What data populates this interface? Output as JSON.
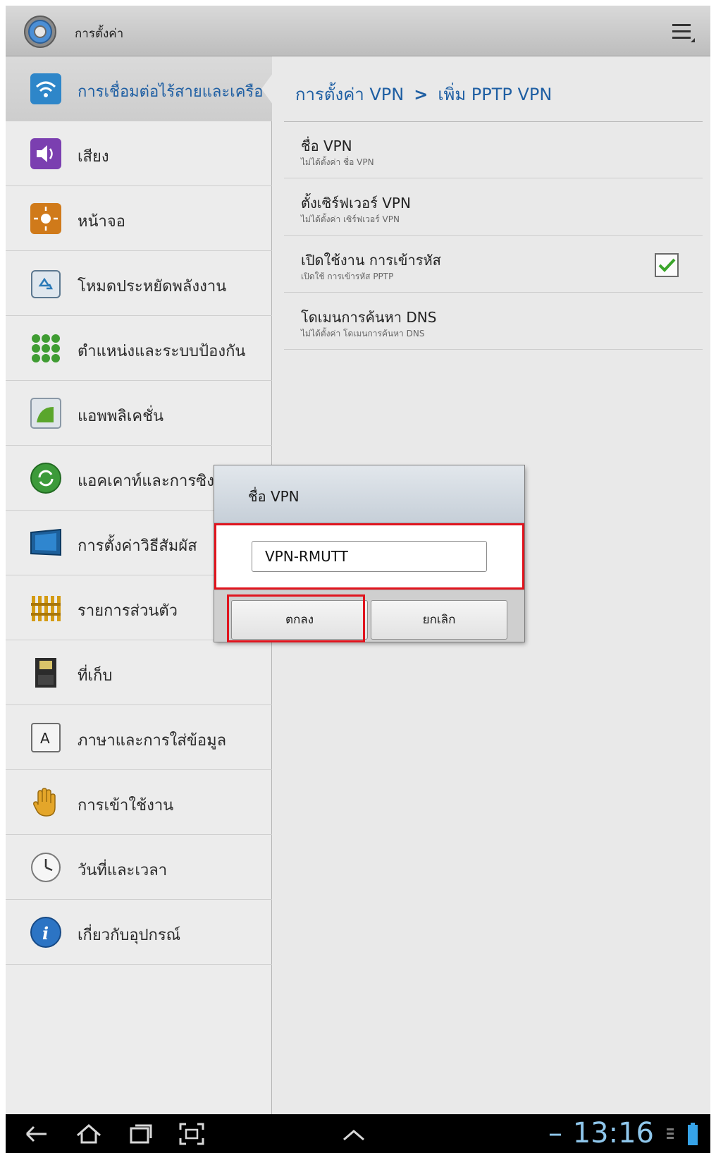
{
  "actionbar": {
    "title": "การตั้งค่า",
    "app_icon": "settings-gear-icon",
    "menu_icon": "menu-icon"
  },
  "sidebar": {
    "items": [
      {
        "label": "การเชื่อมต่อไร้สายและเครือข่าย",
        "icon": "wifi-icon",
        "selected": true
      },
      {
        "label": "เสียง",
        "icon": "speaker-icon"
      },
      {
        "label": "หน้าจอ",
        "icon": "brightness-icon"
      },
      {
        "label": "โหมดประหยัดพลังงาน",
        "icon": "power-saving-icon"
      },
      {
        "label": "ตำแหน่งและระบบป้องกัน",
        "icon": "location-lock-icon"
      },
      {
        "label": "แอพพลิเคชั่น",
        "icon": "android-icon"
      },
      {
        "label": "แอคเคาท์และการซิงค์",
        "icon": "sync-icon"
      },
      {
        "label": "การตั้งค่าวิธีสัมผัส",
        "icon": "motion-icon"
      },
      {
        "label": "รายการส่วนตัว",
        "icon": "privacy-icon"
      },
      {
        "label": "ที่เก็บ",
        "icon": "sd-card-icon"
      },
      {
        "label": "ภาษาและการใส่ข้อมูล",
        "icon": "keyboard-icon"
      },
      {
        "label": "การเข้าใช้งาน",
        "icon": "hand-icon"
      },
      {
        "label": "วันที่และเวลา",
        "icon": "clock-icon"
      },
      {
        "label": "เกี่ยวกับอุปกรณ์",
        "icon": "info-icon"
      }
    ]
  },
  "breadcrumb": {
    "parent": "การตั้งค่า VPN",
    "separator": ">",
    "current": "เพิ่ม PPTP VPN"
  },
  "vpn_settings": [
    {
      "title": "ชื่อ VPN",
      "subtitle": "ไม่ได้ตั้งค่า ชื่อ VPN"
    },
    {
      "title": "ตั้งเซิร์ฟเวอร์ VPN",
      "subtitle": "ไม่ได้ตั้งค่า เซิร์ฟเวอร์ VPN"
    },
    {
      "title": "เปิดใช้งาน การเข้ารหัส",
      "subtitle": "เปิดใช้ การเข้ารหัส PPTP",
      "checked": true
    },
    {
      "title": "โดเมนการค้นหา DNS",
      "subtitle": "ไม่ได้ตั้งค่า โดเมนการค้นหา DNS"
    }
  ],
  "dialog": {
    "title": "ชื่อ VPN",
    "input_value": "VPN-RMUTT",
    "ok_label": "ตกลง",
    "cancel_label": "ยกเลิก"
  },
  "navbar": {
    "clock": "13:16",
    "icons": [
      "back-icon",
      "home-icon",
      "recent-apps-icon",
      "screenshot-icon",
      "up-chevron-icon"
    ]
  },
  "colors": {
    "accent": "#1f5fa3",
    "highlight": "#e0141e",
    "clock": "#8fc7ec"
  }
}
